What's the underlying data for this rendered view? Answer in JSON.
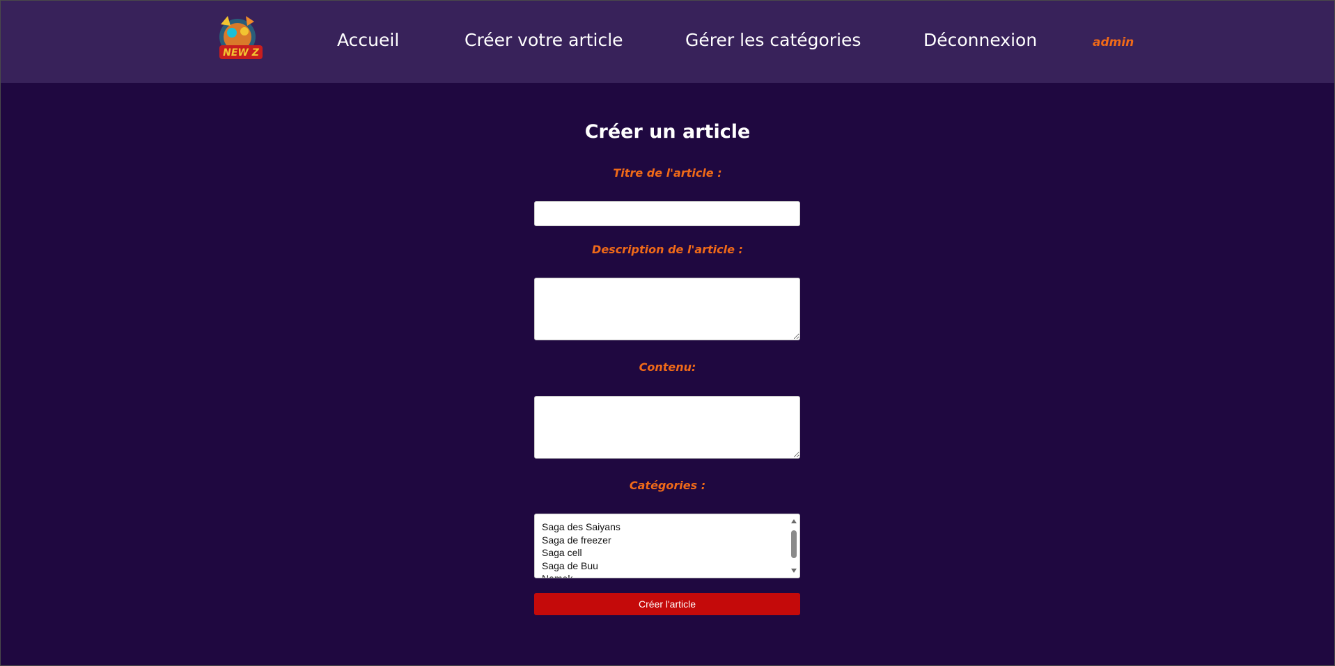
{
  "header": {
    "logo_text": "NEW Z",
    "nav": {
      "accueil": "Accueil",
      "creer": "Créer votre article",
      "gerer": "Gérer les catégories",
      "deconnexion": "Déconnexion"
    },
    "user": "admin"
  },
  "form": {
    "title": "Créer un article",
    "titre_label": "Titre de l'article :",
    "titre_value": "",
    "description_label": "Description de l'article :",
    "description_value": "",
    "contenu_label": "Contenu:",
    "contenu_value": "",
    "categories_label": "Catégories :",
    "categories": [
      "Saga des Saiyans",
      "Saga de freezer",
      "Saga cell",
      "Saga de Buu",
      "Namek"
    ],
    "submit_label": "Créer l'article"
  },
  "colors": {
    "header_bg": "#38225a",
    "page_bg": "#1f0840",
    "accent_orange": "#f06a18",
    "button_red": "#c40a0a"
  }
}
